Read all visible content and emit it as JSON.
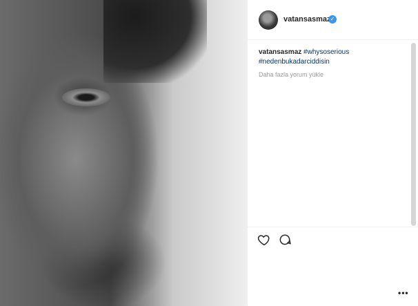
{
  "post": {
    "username": "vatansasmaz",
    "caption": {
      "username": "vatansasmaz",
      "tags": [
        "#whysoserious",
        "#nedenbukadarciddisin"
      ]
    },
    "load_more_label": "Daha fazla yorum yükle"
  },
  "icons": {
    "verified": "verified-badge-icon",
    "like": "heart-icon",
    "comment": "comment-icon",
    "more": "more-options-icon"
  },
  "colors": {
    "verified": "#3897f0",
    "hashtag": "#003569",
    "muted": "#999999",
    "text": "#262626"
  }
}
